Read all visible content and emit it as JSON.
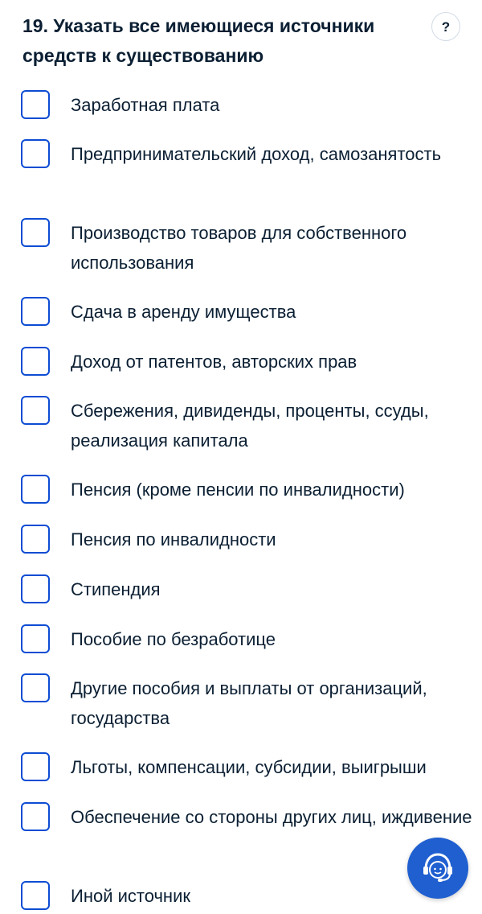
{
  "question": {
    "title": "19. Указать все имеющиеся источники средств к существованию",
    "help_label": "?"
  },
  "options": [
    {
      "label": "Заработная плата",
      "checked": false
    },
    {
      "label": "Предпринимательский доход, самозанятость",
      "checked": false
    },
    {
      "label": "Производство товаров для собственного использования",
      "checked": false
    },
    {
      "label": "Сдача в аренду имущества",
      "checked": false
    },
    {
      "label": "Доход от патентов, авторских прав",
      "checked": false
    },
    {
      "label": "Сбережения, дивиденды, проценты, ссуды, реализация капитала",
      "checked": false
    },
    {
      "label": "Пенсия (кроме пенсии по инвалидности)",
      "checked": false
    },
    {
      "label": "Пенсия по инвалидности",
      "checked": false
    },
    {
      "label": "Стипендия",
      "checked": false
    },
    {
      "label": "Пособие по безработице",
      "checked": false
    },
    {
      "label": "Другие пособия и выплаты от организаций, государства",
      "checked": false
    },
    {
      "label": "Льготы, компенсации, субсидии, выигрыши",
      "checked": false
    },
    {
      "label": "Обеспечение со стороны других лиц, иждивение",
      "checked": false
    },
    {
      "label": "Иной источник",
      "checked": false
    }
  ],
  "support": {
    "icon": "support-operator-icon"
  },
  "colors": {
    "accent": "#0d4cd3",
    "text": "#0b1f33",
    "support_bg": "#1f5fd0"
  }
}
